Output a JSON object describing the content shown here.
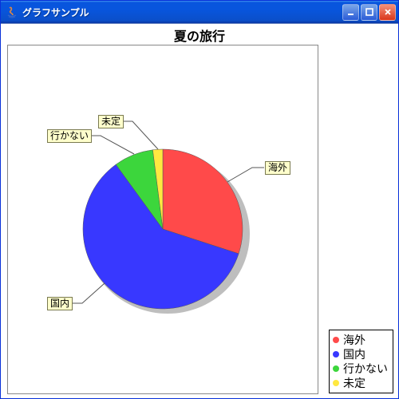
{
  "window": {
    "title": "グラフサンプル",
    "min_tooltip": "最小化",
    "max_tooltip": "最大化",
    "close_tooltip": "閉じる"
  },
  "chart_data": {
    "type": "pie",
    "title": "夏の旅行",
    "series": [
      {
        "name": "海外",
        "value": 30,
        "color": "#ff4a4a"
      },
      {
        "name": "国内",
        "value": 60,
        "color": "#3838ff"
      },
      {
        "name": "行かない",
        "value": 7,
        "color": "#3cd63c"
      },
      {
        "name": "未定",
        "value": 3,
        "color": "#ffe840"
      }
    ],
    "legend_position": "bottom-right",
    "callouts": true
  }
}
